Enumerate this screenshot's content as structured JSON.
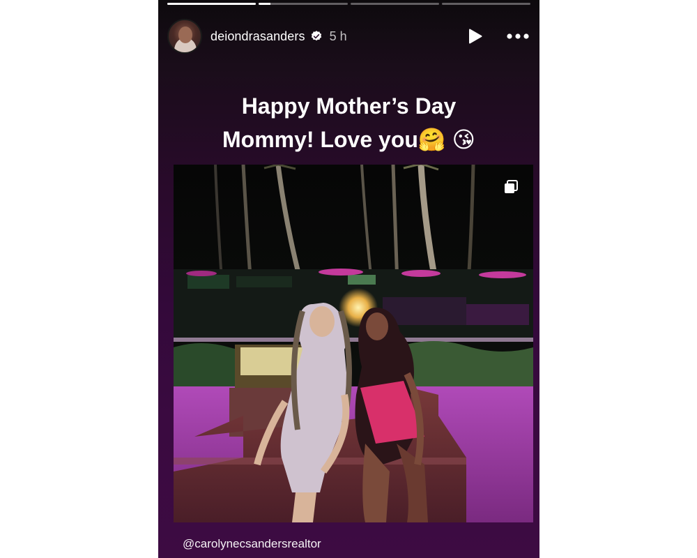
{
  "story": {
    "progress": [
      {
        "fill": 1.0
      },
      {
        "fill": 0.13
      },
      {
        "fill": 0.0
      },
      {
        "fill": 0.0
      }
    ],
    "header": {
      "username": "deiondrasanders",
      "time": "5 h",
      "verified": true
    },
    "caption": {
      "line1": "Happy Mother’s Day",
      "line2": "Mommy! Love you🤗 😘"
    },
    "photo": {
      "multiple_icon": "carousel-icon"
    },
    "mention": "@carolynecsandersrealtor"
  }
}
